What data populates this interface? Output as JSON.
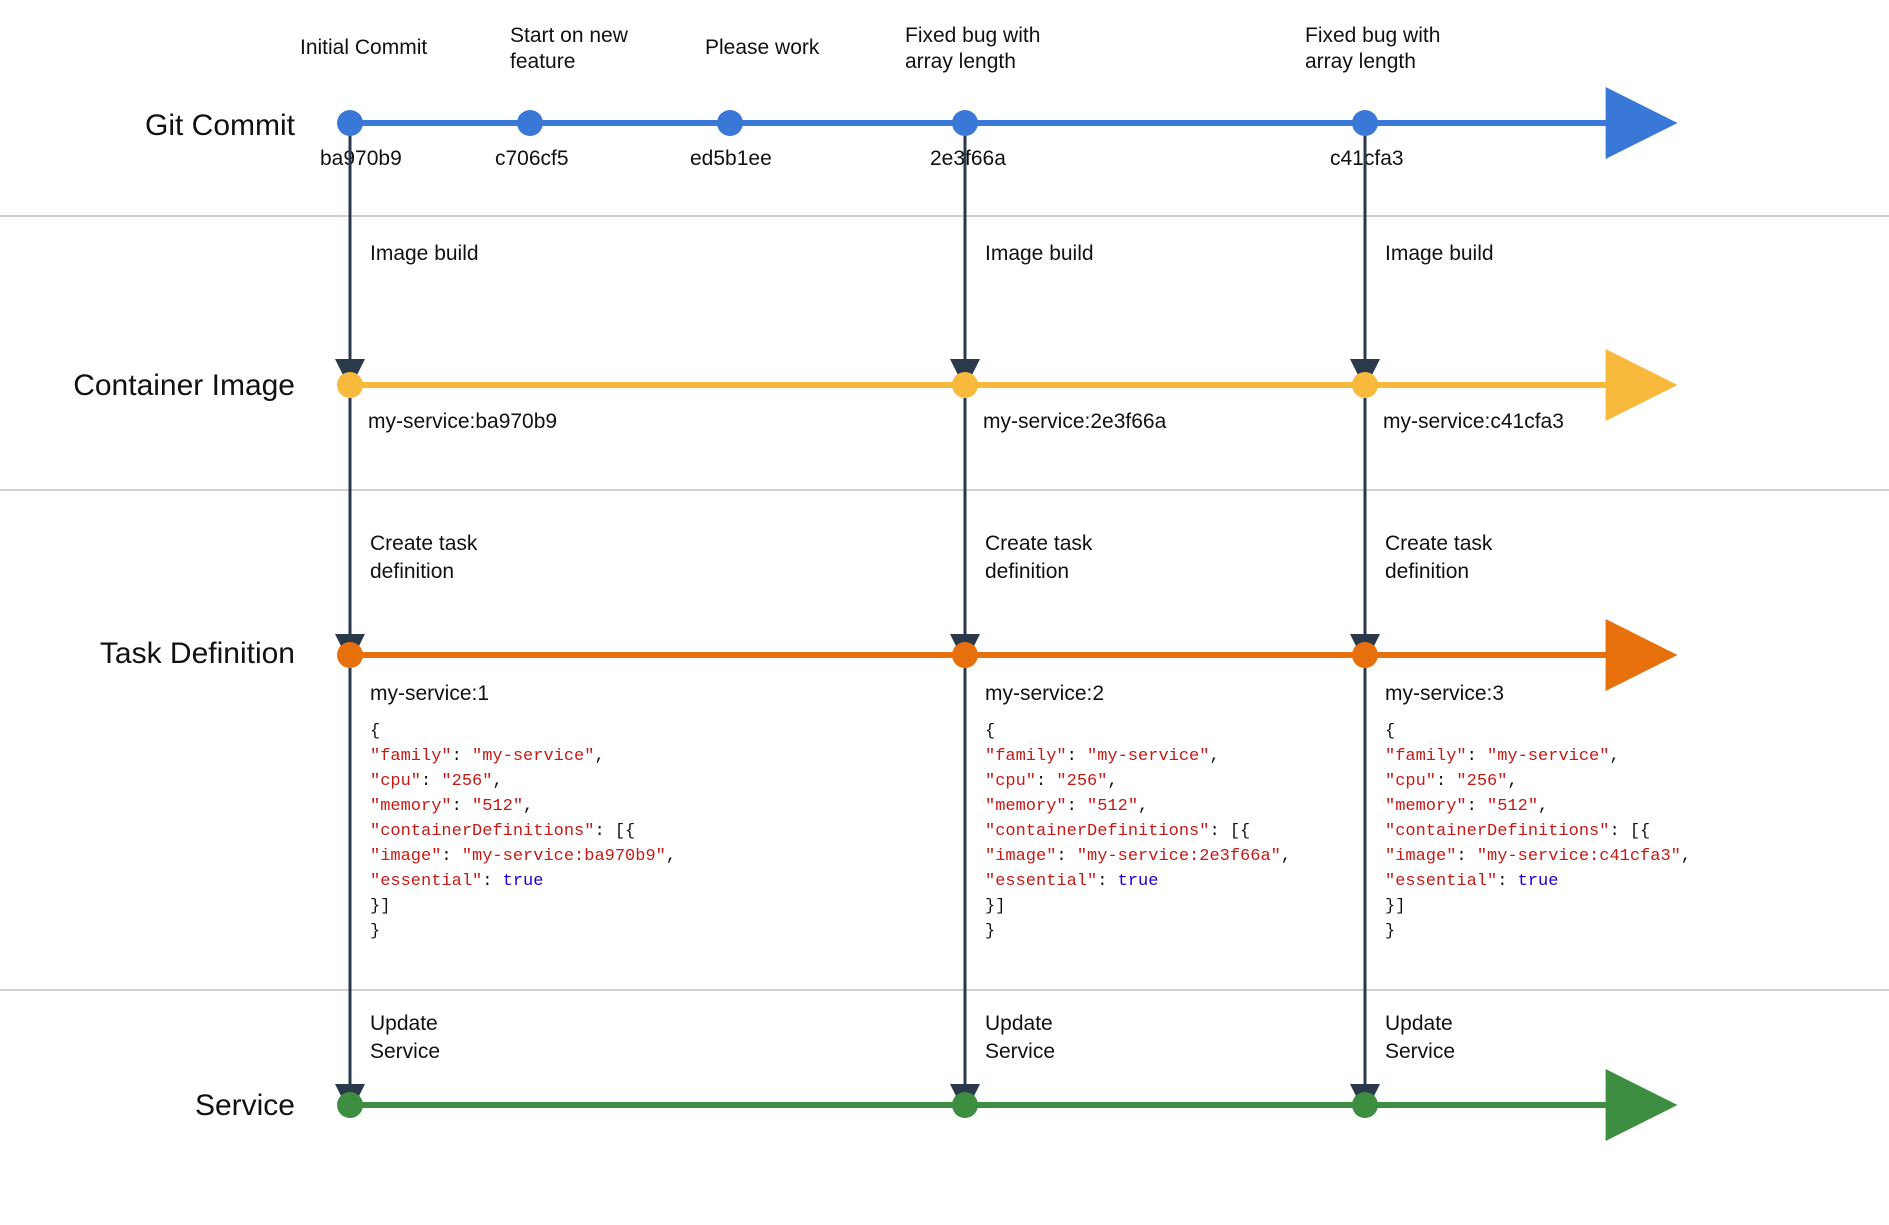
{
  "rows": {
    "git": "Git Commit",
    "image": "Container Image",
    "taskdef": "Task Definition",
    "service": "Service"
  },
  "commits": [
    {
      "msg_l1": "Initial Commit",
      "msg_l2": "",
      "hash": "ba970b9"
    },
    {
      "msg_l1": "Start on new",
      "msg_l2": "feature",
      "hash": "c706cf5"
    },
    {
      "msg_l1": "Please work",
      "msg_l2": "",
      "hash": "ed5b1ee"
    },
    {
      "msg_l1": "Fixed bug with",
      "msg_l2": "array length",
      "hash": "2e3f66a"
    },
    {
      "msg_l1": "Fixed bug with",
      "msg_l2": "array length",
      "hash": "c41cfa3"
    }
  ],
  "build_label_l1": "Image build",
  "images": [
    "my-service:ba970b9",
    "my-service:2e3f66a",
    "my-service:c41cfa3"
  ],
  "taskdef_label_l1": "Create task",
  "taskdef_label_l2": "definition",
  "taskdefs": [
    {
      "name": "my-service:1",
      "image": "my-service:ba970b9"
    },
    {
      "name": "my-service:2",
      "image": "my-service:2e3f66a"
    },
    {
      "name": "my-service:3",
      "image": "my-service:c41cfa3"
    }
  ],
  "taskdef_json": {
    "family": "my-service",
    "cpu": "256",
    "memory": "512",
    "essential": "true"
  },
  "update_label_l1": "Update",
  "update_label_l2": "Service",
  "colors": {
    "blue": "#3a78d8",
    "yellow": "#f6b93b",
    "orange": "#e76f0c",
    "green": "#3e8e41",
    "arrow": "#2b3a4a",
    "divider": "#d0d0d0"
  }
}
